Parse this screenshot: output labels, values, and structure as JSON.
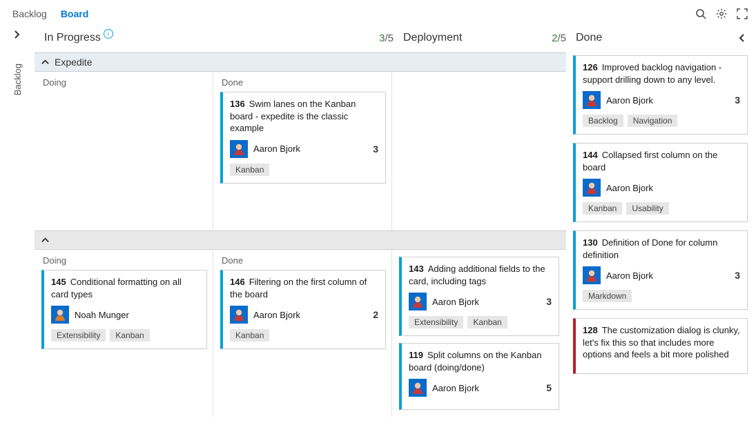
{
  "tabs": {
    "backlog": "Backlog",
    "board": "Board"
  },
  "sidebar": {
    "label": "Backlog"
  },
  "columns": {
    "inProgress": {
      "title": "In Progress",
      "wip_current": "3",
      "wip_limit": "/5",
      "sub": {
        "doing": "Doing",
        "done": "Done"
      }
    },
    "deployment": {
      "title": "Deployment",
      "wip_current": "2",
      "wip_limit": "/5"
    },
    "done": {
      "title": "Done"
    }
  },
  "lanes": {
    "expedite": "Expedite"
  },
  "cards": {
    "c136": {
      "id": "136",
      "title": "Swim lanes on the Kanban board - expedite is the classic example",
      "assignee": "Aaron Bjork",
      "count": "3",
      "tags": [
        "Kanban"
      ]
    },
    "c145": {
      "id": "145",
      "title": "Conditional formatting on all card types",
      "assignee": "Noah Munger",
      "count": "",
      "tags": [
        "Extensibility",
        "Kanban"
      ],
      "orange": true
    },
    "c146": {
      "id": "146",
      "title": "Filtering on the first column of the board",
      "assignee": "Aaron Bjork",
      "count": "2",
      "tags": [
        "Kanban"
      ]
    },
    "c143": {
      "id": "143",
      "title": "Adding additional fields to the card, including tags",
      "assignee": "Aaron Bjork",
      "count": "3",
      "tags": [
        "Extensibility",
        "Kanban"
      ]
    },
    "c119": {
      "id": "119",
      "title": "Split columns on the Kanban board (doing/done)",
      "assignee": "Aaron Bjork",
      "count": "5",
      "tags": []
    },
    "c126": {
      "id": "126",
      "title": "Improved backlog navigation - support drilling down to any level.",
      "assignee": "Aaron Bjork",
      "count": "3",
      "tags": [
        "Backlog",
        "Navigation"
      ]
    },
    "c144": {
      "id": "144",
      "title": "Collapsed first  column on the board",
      "assignee": "Aaron Bjork",
      "count": "",
      "tags": [
        "Kanban",
        "Usability"
      ]
    },
    "c130": {
      "id": "130",
      "title": "Definition of Done for column definition",
      "assignee": "Aaron Bjork",
      "count": "3",
      "tags": [
        "Markdown"
      ]
    },
    "c128": {
      "id": "128",
      "title": "The customization dialog is clunky, let's fix this so that includes more options and feels a bit more polished",
      "assignee": "",
      "count": "",
      "tags": [],
      "red": true
    }
  }
}
